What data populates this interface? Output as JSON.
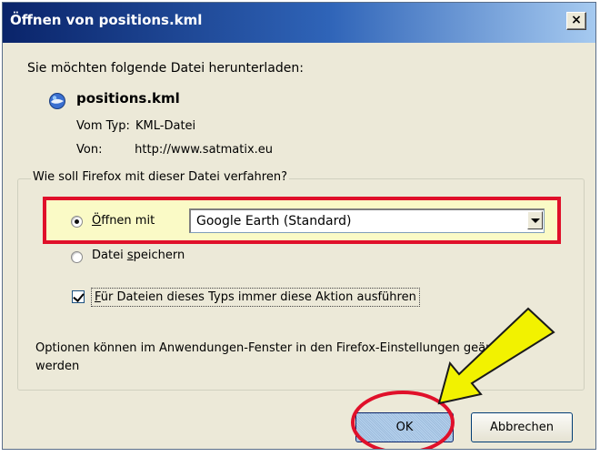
{
  "window": {
    "title": "Öffnen von positions.kml",
    "close_label": "×"
  },
  "intro": "Sie möchten folgende Datei herunterladen:",
  "file": {
    "icon": "google-earth-file-icon",
    "name": "positions.kml",
    "type_label": "Vom Typ:",
    "type_value": "KML-Datei",
    "from_label": "Von:",
    "from_value": "http://www.satmatix.eu"
  },
  "action_group": {
    "legend": "Wie soll Firefox mit dieser Datei verfahren?",
    "open_with": {
      "label_mnemonic": "Ö",
      "label_rest": "ffnen mit",
      "selected": true
    },
    "open_with_app": "Google Earth (Standard)",
    "save_file": {
      "label_before": "Datei ",
      "label_mnemonic": "s",
      "label_after": "peichern",
      "selected": false
    },
    "always_do": {
      "label_mnemonic": "F",
      "label_rest": "ür Dateien dieses Typs immer diese Aktion ausführen",
      "checked": true
    }
  },
  "options_note": "Optionen können im Anwendungen-Fenster in den Firefox-Einstellungen geändert werden",
  "buttons": {
    "ok": "OK",
    "cancel": "Abbrechen"
  },
  "annotations": {
    "highlight_color": "#e0102a",
    "arrow_color": "#f2f200",
    "dialog_bg": "#ece9d8"
  }
}
